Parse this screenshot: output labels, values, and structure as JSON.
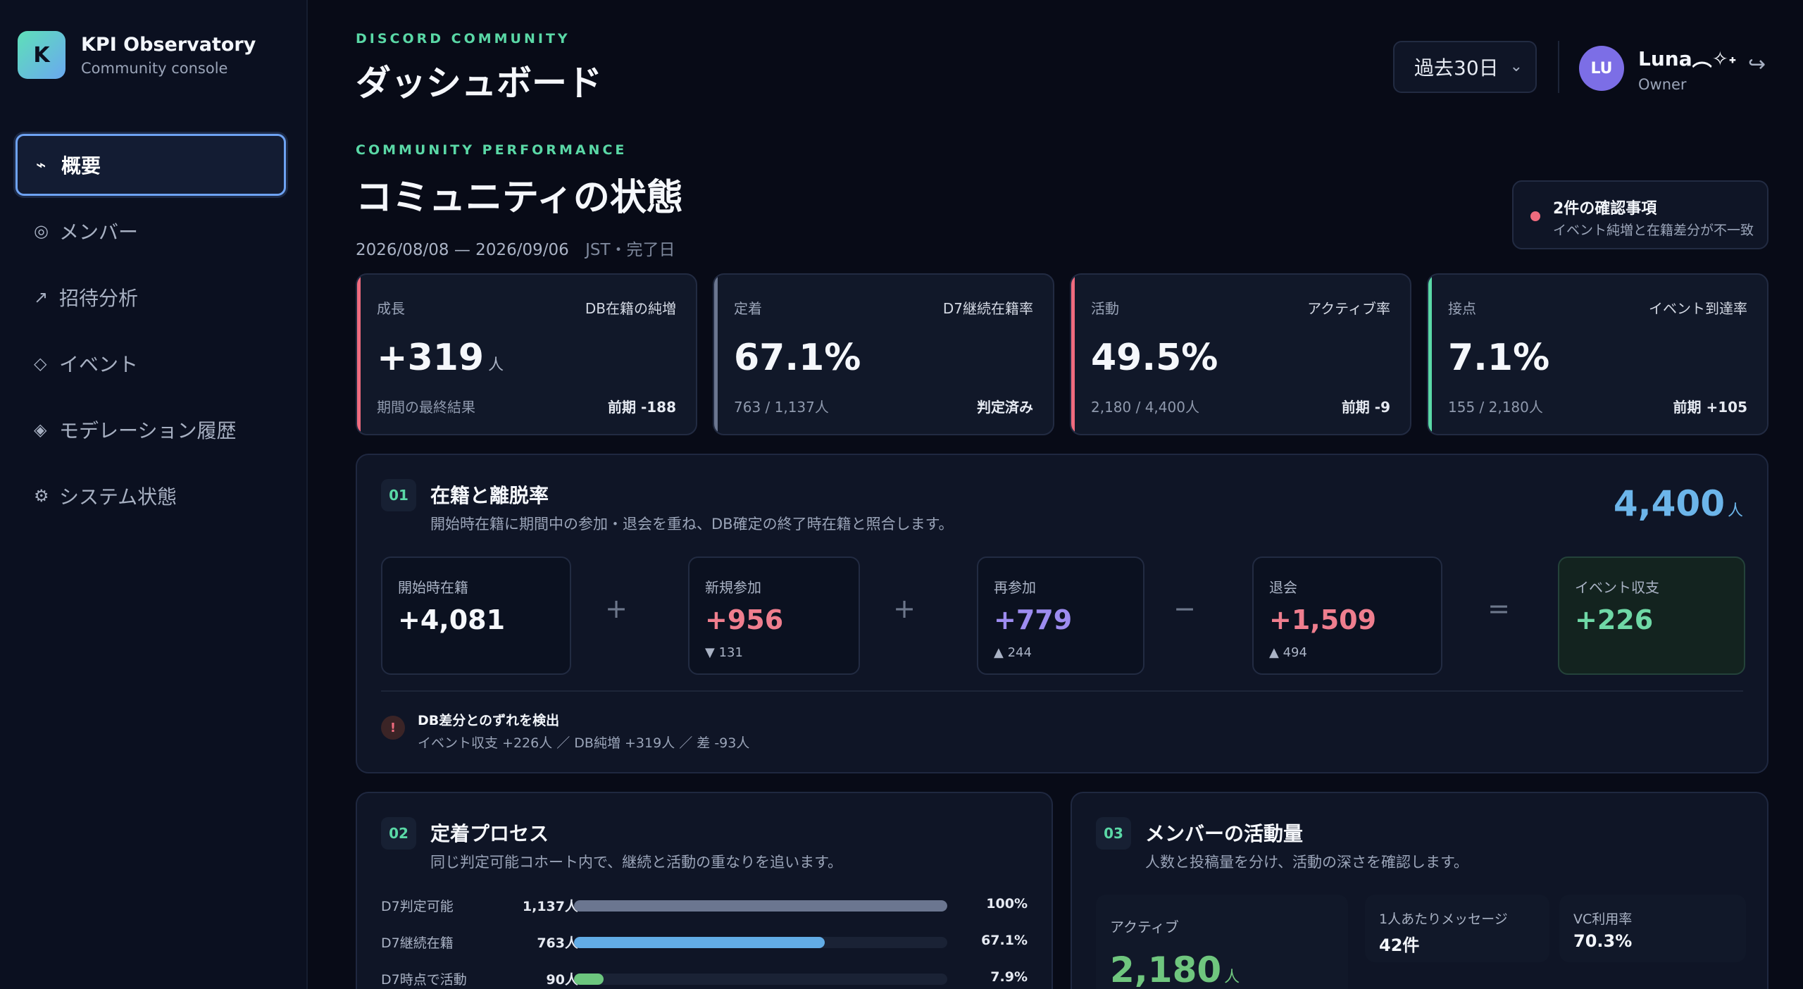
{
  "brand": {
    "logo_letter": "K",
    "name": "KPI Observatory",
    "subtitle": "Community console"
  },
  "nav": [
    {
      "icon": "⌁",
      "label": "概要",
      "active": true
    },
    {
      "icon": "◎",
      "label": "メンバー"
    },
    {
      "icon": "↗",
      "label": "招待分析"
    },
    {
      "icon": "◇",
      "label": "イベント"
    },
    {
      "icon": "◈",
      "label": "モデレーション履歴"
    },
    {
      "icon": "⚙",
      "label": "システム状態"
    }
  ],
  "header": {
    "eyebrow": "DISCORD COMMUNITY",
    "title": "ダッシュボード"
  },
  "period": {
    "selected": "過去30日"
  },
  "user": {
    "initials": "LU",
    "name": "Luna︵✧˖",
    "role": "Owner"
  },
  "performance": {
    "eyebrow": "COMMUNITY PERFORMANCE",
    "title": "コミュニティの状態",
    "date_range": "2026/08/08 — 2026/09/06",
    "date_note": "JST・完了日"
  },
  "alert": {
    "title": "2件の確認事項",
    "desc": "イベント純増と在籍差分が不一致",
    "color": "#ef6b7e"
  },
  "kpis": [
    {
      "label": "成長",
      "metric": "DB在籍の純増",
      "value": "+319",
      "unit": "人",
      "foot": "期間の最終結果",
      "foot_right": "前期 -188",
      "accent": "#ef6b7e"
    },
    {
      "label": "定着",
      "metric": "D7継続在籍率",
      "value": "67.1%",
      "unit": "",
      "foot": "763 / 1,137人",
      "foot_right": "判定済み",
      "accent": "#6b7690"
    },
    {
      "label": "活動",
      "metric": "アクティブ率",
      "value": "49.5%",
      "unit": "",
      "foot": "2,180 / 4,400人",
      "foot_right": "前期 -9",
      "accent": "#ef6b7e"
    },
    {
      "label": "接点",
      "metric": "イベント到達率",
      "value": "7.1%",
      "unit": "",
      "foot": "155 / 2,180人",
      "foot_right": "前期 +105",
      "accent": "#5ad8a6"
    }
  ],
  "section1": {
    "number": "01",
    "title": "在籍と離脱率",
    "desc": "開始時在籍に期間中の参加・退会を重ね、DB確定の終了時在籍と照合します。",
    "total": "4,400",
    "total_unit": "人",
    "flow": [
      {
        "label": "開始時在籍",
        "value": "+4,081",
        "sub": "",
        "color": "#f5f7fb"
      },
      {
        "label": "新規参加",
        "value": "+956",
        "sub": "▼ 131",
        "color": "#ef7e8e"
      },
      {
        "label": "再参加",
        "value": "+779",
        "sub": "▲ 244",
        "color": "#9d8cf0"
      },
      {
        "label": "退会",
        "value": "+1,509",
        "sub": "▲ 494",
        "color": "#ef7e8e"
      },
      {
        "label": "イベント収支",
        "value": "+226",
        "sub": "",
        "color": "#6fd8a6"
      }
    ],
    "operators": [
      "+",
      "+",
      "−",
      "="
    ],
    "warning": {
      "mark": "!",
      "title": "DB差分とのずれを検出",
      "desc": "イベント収支 +226人 ／ DB純増 +319人 ／ 差 -93人"
    }
  },
  "section2": {
    "number": "02",
    "title": "定着プロセス",
    "desc": "同じ判定可能コホート内で、継続と活動の重なりを追います。",
    "rows": [
      {
        "label": "D7判定可能",
        "count": "1,137人",
        "pct": "100%",
        "fraction": 1.0,
        "color": "#6b7690"
      },
      {
        "label": "D7継続在籍",
        "count": "763人",
        "pct": "67.1%",
        "fraction": 0.671,
        "color": "#62ace6"
      },
      {
        "label": "D7時点で活動",
        "count": "90人",
        "pct": "7.9%",
        "fraction": 0.079,
        "color": "#6cc67e"
      }
    ]
  },
  "section3": {
    "number": "03",
    "title": "メンバーの活動量",
    "desc": "人数と投稿量を分け、活動の深さを確認します。",
    "active": {
      "label": "アクティブ",
      "value": "2,180",
      "unit": "人"
    },
    "stats": [
      {
        "label": "1人あたりメッセージ",
        "value": "42件"
      },
      {
        "label": "VC利用率",
        "value": "70.3%"
      }
    ]
  },
  "icons": {
    "nav": [
      "overview-icon",
      "members-icon",
      "invite-icon",
      "event-icon",
      "moderation-icon",
      "system-icon"
    ],
    "logout": "↪",
    "chevron": "⌄"
  }
}
